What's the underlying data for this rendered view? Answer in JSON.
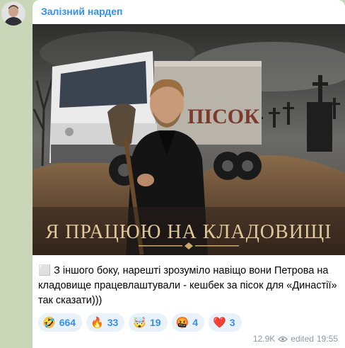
{
  "channel": {
    "name": "Залізний нардеп"
  },
  "image": {
    "truck_label": "ПІСОК",
    "headline": "Я ПРАЦЮЮ НА КЛАДОВИЩІ"
  },
  "post": {
    "caption": "⬜ З іншого боку, нарешті зрозуміло навіщо вони Петрова на кладовище працевлаштували - кешбек за пісок для «Династії» так сказати)))"
  },
  "reactions": [
    {
      "emoji": "🤣",
      "count": "664"
    },
    {
      "emoji": "🔥",
      "count": "33"
    },
    {
      "emoji": "🤯",
      "count": "19"
    },
    {
      "emoji": "🤬",
      "count": "4"
    },
    {
      "emoji": "❤️",
      "count": "3"
    }
  ],
  "meta": {
    "views": "12.9K",
    "status": "edited",
    "time": "19:55"
  }
}
